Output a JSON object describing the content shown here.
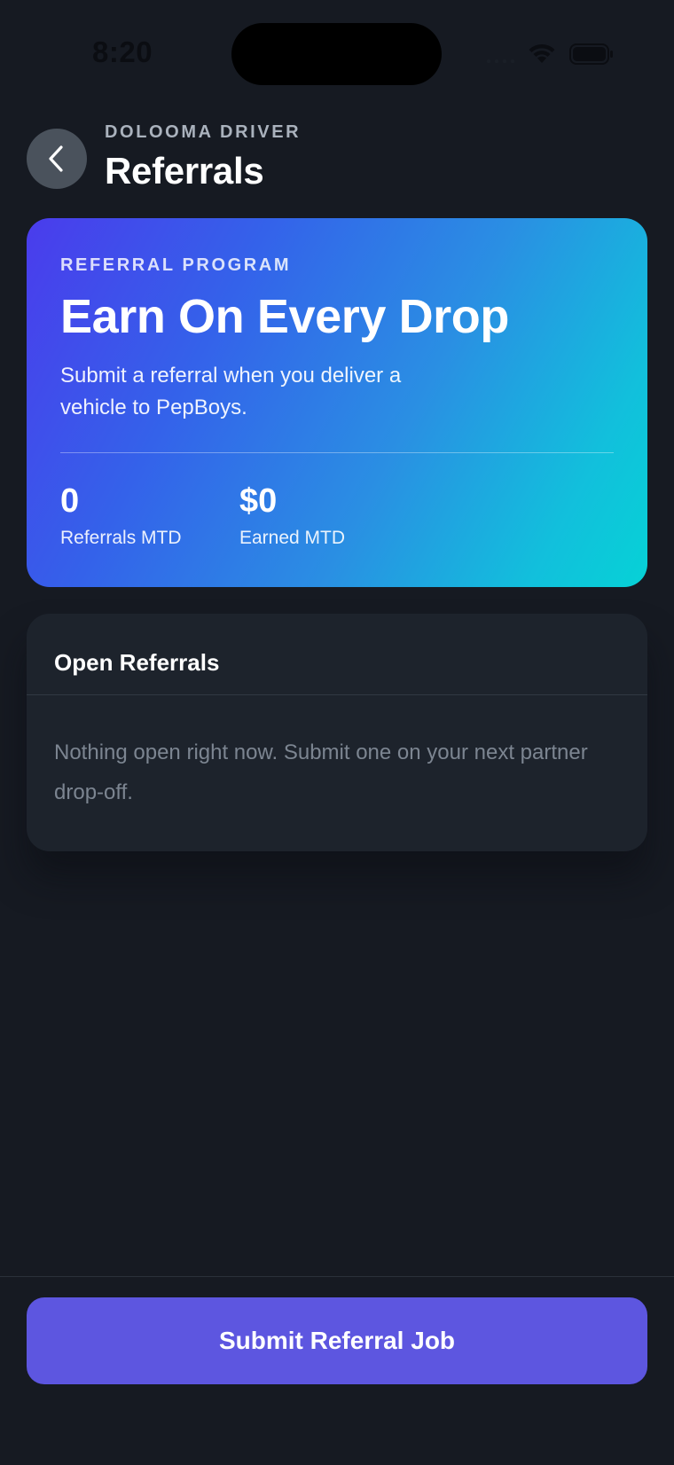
{
  "status_bar": {
    "time": "8:20"
  },
  "header": {
    "eyebrow": "DOLOOMA DRIVER",
    "title": "Referrals",
    "back_icon": "chevron-left-icon"
  },
  "hero": {
    "eyebrow": "REFERRAL PROGRAM",
    "title": "Earn On Every Drop",
    "subtitle": "Submit a referral when you deliver a vehicle to PepBoys.",
    "stats": [
      {
        "value": "0",
        "label": "Referrals MTD"
      },
      {
        "value": "$0",
        "label": "Earned MTD"
      }
    ]
  },
  "open_referrals": {
    "title": "Open Referrals",
    "empty_message": "Nothing open right now. Submit one on your next partner drop-off."
  },
  "footer": {
    "submit_label": "Submit Referral Job"
  },
  "colors": {
    "background": "#161a22",
    "card": "#1d232c",
    "accent": "#5d56e0",
    "gradient_start": "#4a3cec",
    "gradient_end": "#06d2d6"
  }
}
